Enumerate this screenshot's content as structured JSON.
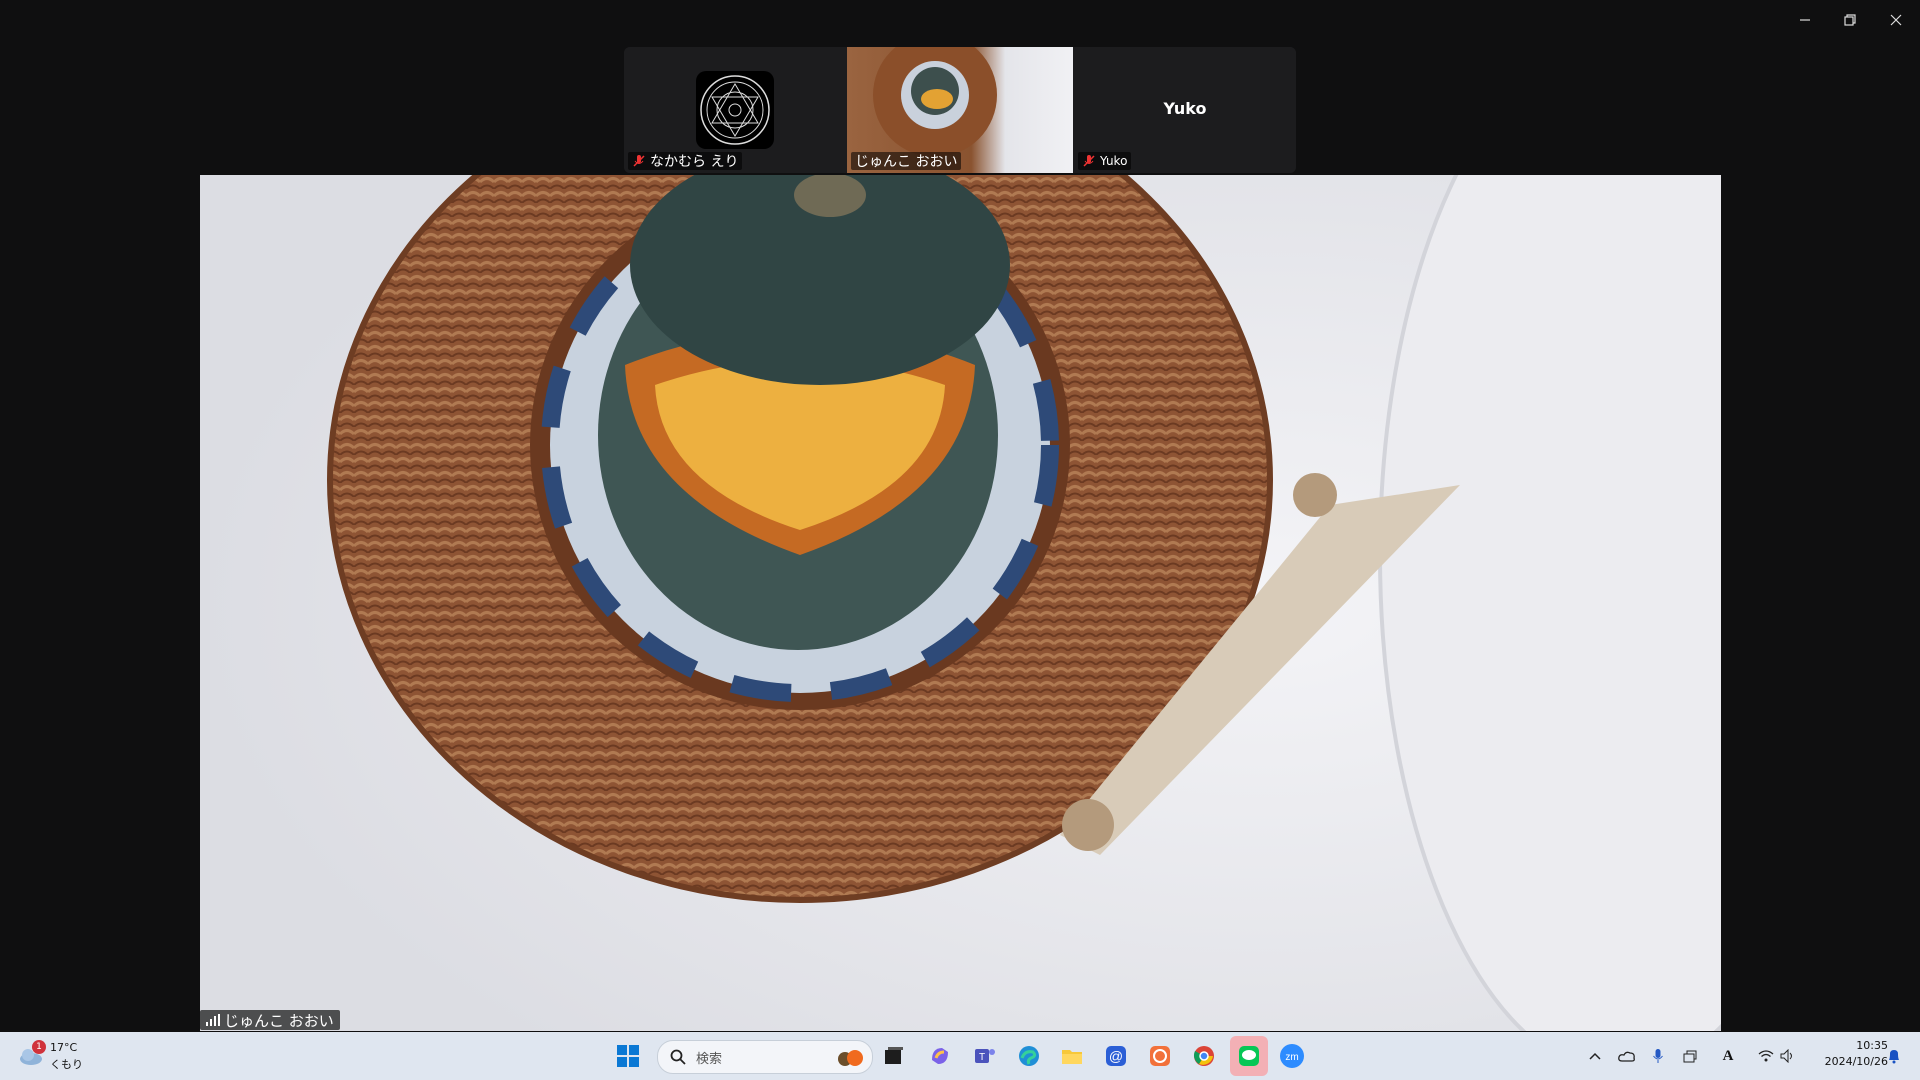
{
  "window": {
    "minimize_icon": "minimize-icon",
    "restore_icon": "restore-icon",
    "close_icon": "close-icon"
  },
  "participants": [
    {
      "name": "なかむら えり",
      "muted": true
    },
    {
      "name": "じゅんこ おおい",
      "muted": false,
      "active": true
    },
    {
      "name": "Yuko",
      "display_text": "Yuko",
      "muted": true
    }
  ],
  "main_video": {
    "speaker_name": "じゅんこ おおい",
    "signal_icon": "signal-bars-icon"
  },
  "taskbar": {
    "weather": {
      "temp": "17°C",
      "condition": "くもり",
      "badge": "1"
    },
    "search_placeholder": "検索",
    "apps": [
      "start",
      "search",
      "file-explorer",
      "copilot",
      "teams",
      "edge",
      "folder",
      "mail",
      "app-orange",
      "chrome",
      "line",
      "zoom"
    ],
    "clock": {
      "time": "10:35",
      "date": "2024/10/26"
    },
    "ime_indicator": "A"
  }
}
